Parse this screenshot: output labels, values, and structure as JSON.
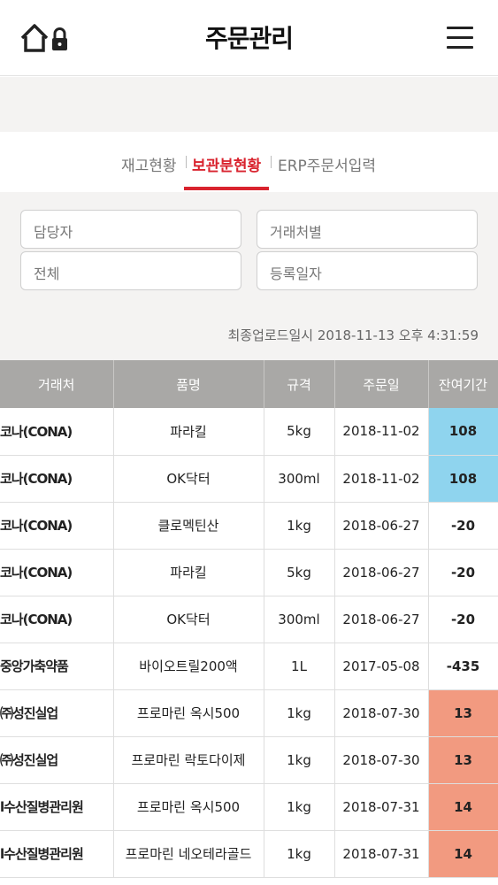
{
  "header": {
    "title": "주문관리"
  },
  "tabs": [
    {
      "label": "재고현황",
      "active": false
    },
    {
      "label": "보관분현황",
      "active": true
    },
    {
      "label": "ERP주문서입력",
      "active": false
    }
  ],
  "filters": {
    "manager": "담당자",
    "client": "거래처별",
    "scope": "전체",
    "regdate": "등록일자"
  },
  "last_upload": "최종업로드일시 2018-11-13 오후 4:31:59",
  "table": {
    "headers": [
      "거래처",
      "품명",
      "규격",
      "주문일",
      "잔여기간"
    ],
    "rows": [
      {
        "client": "코나(CONA)",
        "product": "파라킬",
        "spec": "5kg",
        "date": "2018-11-02",
        "remain": "108",
        "tone": "blue"
      },
      {
        "client": "코나(CONA)",
        "product": "OK닥터",
        "spec": "300ml",
        "date": "2018-11-02",
        "remain": "108",
        "tone": "blue"
      },
      {
        "client": "코나(CONA)",
        "product": "클로멕틴산",
        "spec": "1kg",
        "date": "2018-06-27",
        "remain": "-20",
        "tone": "none"
      },
      {
        "client": "코나(CONA)",
        "product": "파라킬",
        "spec": "5kg",
        "date": "2018-06-27",
        "remain": "-20",
        "tone": "none"
      },
      {
        "client": "코나(CONA)",
        "product": "OK닥터",
        "spec": "300ml",
        "date": "2018-06-27",
        "remain": "-20",
        "tone": "none"
      },
      {
        "client": "중앙가축약품",
        "product": "바이오트릴200액",
        "spec": "1L",
        "date": "2017-05-08",
        "remain": "-435",
        "tone": "none"
      },
      {
        "client": "㈜성진실업",
        "product": "프로마린 옥시500",
        "spec": "1kg",
        "date": "2018-07-30",
        "remain": "13",
        "tone": "red"
      },
      {
        "client": "㈜성진실업",
        "product": "프로마린 락토다이제",
        "spec": "1kg",
        "date": "2018-07-30",
        "remain": "13",
        "tone": "red"
      },
      {
        "client": "l수산질병관리원",
        "product": "프로마린 옥시500",
        "spec": "1kg",
        "date": "2018-07-31",
        "remain": "14",
        "tone": "red"
      },
      {
        "client": "l수산질병관리원",
        "product": "프로마린 네오테라골드",
        "spec": "1kg",
        "date": "2018-07-31",
        "remain": "14",
        "tone": "red"
      }
    ]
  }
}
